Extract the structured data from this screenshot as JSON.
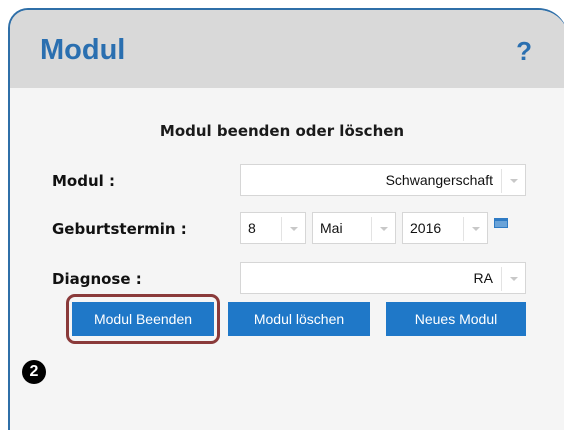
{
  "panel": {
    "title": "Modul",
    "help": "?"
  },
  "form": {
    "heading": "Modul beenden oder löschen",
    "modul_label": "Modul :",
    "modul_value": "Schwangerschaft",
    "birth_label": "Geburtstermin :",
    "birth_day": "8",
    "birth_month": "Mai",
    "birth_year": "2016",
    "diagnosis_label": "Diagnose :",
    "diagnosis_value": "RA"
  },
  "buttons": {
    "end": "Modul Beenden",
    "delete": "Modul löschen",
    "new": "Neues Modul"
  },
  "step_marker": "2",
  "icons": [
    "help-icon",
    "chevron-down-icon",
    "calendar-icon"
  ],
  "colors": {
    "accent": "#2a6fb0",
    "button": "#1f78c8",
    "highlight": "#8a3a3a"
  }
}
